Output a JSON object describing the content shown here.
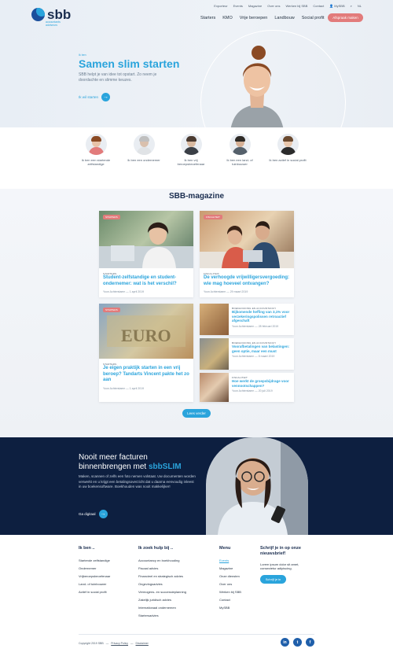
{
  "brand": {
    "name": "sbb",
    "subline": "accountants adviseurs"
  },
  "topnav": [
    "Exporteur",
    "Events",
    "Magazine",
    "Over ons",
    "Werken bij SBB",
    "Contact",
    "MySBB",
    "NL"
  ],
  "mainnav": [
    "Starters",
    "KMO",
    "Vrije beroepen",
    "Landbouw",
    "Social profit"
  ],
  "cta_top": "Afspraak maken",
  "hero": {
    "tag": "Ik ben",
    "title": "Samen slim starten",
    "text": "SBB helpt je van idee tot opstart. Zo neem je doordachte en slimme keuzes.",
    "link": "Ik wil starten"
  },
  "profiles": [
    {
      "label": "Ik ben een startende zelfstandige"
    },
    {
      "label": "Ik ben een ondernemer"
    },
    {
      "label": "Ik ben vrij beroepsbeoefenaar"
    },
    {
      "label": "Ik ben een land- of tuinbouwer"
    },
    {
      "label": "Ik ben actief in social profit"
    }
  ],
  "magazine": {
    "title": "SBB-magazine",
    "more": "Lees verder",
    "big_cards": [
      {
        "badge": "",
        "category": "Starters",
        "title": "Student-zelfstandige en student-ondernemer: wat is het verschil?",
        "author": "Yoon Achterstaem",
        "date": "1 april 2019"
      },
      {
        "badge": "",
        "category": "Fiscaliteit",
        "title": "De verhoogde vrijwilligersvergoeding: wie mag hoeveel ontvangen?",
        "author": "Yoon Achterstaem",
        "date": "29 maart 2019"
      },
      {
        "badge": "",
        "category": "Starters",
        "title": "Je eigen praktijk starten in een vrij beroep? Tandarts Vincent pakte het zo aan",
        "author": "Yoon Achterstaem",
        "date": "1 april 2019"
      }
    ],
    "small_cards": [
      {
        "category": "Boekhouding en accountancy",
        "title": "Bijkomende heffing van 3,1% voor verzekeringspolissen retroactief afgeschaft",
        "author": "Yoon Achterstaem",
        "date": "28 februari 2019"
      },
      {
        "category": "Boekhouding en accountancy",
        "title": "Voorafbetalingen van belastingen: geen optie, maar een must",
        "author": "Yoon Achterstaem",
        "date": "8 maart 2019"
      },
      {
        "category": "Fiscaliteit",
        "title": "Hoe werkt de groepsbijdrage voor vennootschappen?",
        "author": "Yoon Achterstaem",
        "date": "20 juli 2019"
      }
    ]
  },
  "banner": {
    "title_line1": "Nooit meer facturen",
    "title_line2": "binnenbrengen met",
    "title_accent": "sbbSLIM",
    "text": "Maken, scannen of zelfs een foto nemen volstaat. Uw documenten worden verwerkt en u krijgt een betalingsoverzicht dat u daarna eenvoudig inleest in uw boekensoftware. Boekhouden was nooit makkelijker!",
    "link": "Ga digitaal"
  },
  "footer": {
    "col1": {
      "head": "Ik ben ..",
      "items": [
        "Startende zelfstandige",
        "Ondernemer",
        "Vrijberoepsbeoefenaar",
        "Land- of tuinbouwer",
        "Actief in social profit"
      ]
    },
    "col2": {
      "head": "Ik zoek hulp bij ..",
      "items": [
        "Accountancy en boekhouding",
        "Fiscaal advies",
        "Financieel en strategisch advies",
        "Ongevingsadvies",
        "Vermogens- en successieplanning",
        "Zakelijk juridisch advies",
        "Internationaal ondernemen",
        "Startersadvies"
      ]
    },
    "col3": {
      "head": "Menu",
      "items": [
        "Events",
        "Magazine",
        "Onze diensten",
        "Over ons",
        "Werken bij SBB",
        "Contact",
        "MySBB"
      ]
    },
    "news": {
      "head": "Schrijf je in op onze nieuwsbrief!",
      "text": "Lorem ipsum dolor sit amet, consectetur adipiscing.",
      "button": "Schrijf je in"
    },
    "copyright": "Copyright 2019 SBB",
    "privacy": "Privacy Policy",
    "disclaimer": "Disclaimer",
    "socials": [
      "in",
      "t",
      "f"
    ]
  },
  "colors": {
    "accent": "#2aa4dc",
    "cta": "#e27b7b",
    "navy": "#0d1f40"
  }
}
